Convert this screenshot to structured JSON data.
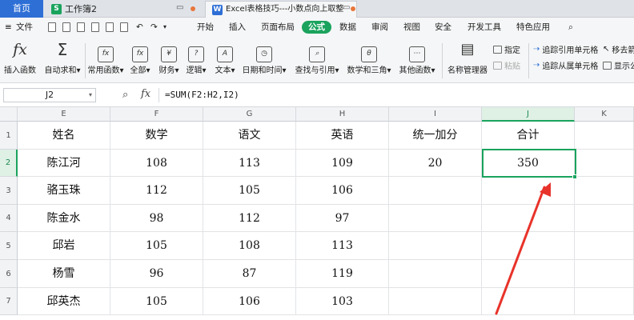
{
  "tabs": {
    "home": "首页",
    "workbook": "工作簿2",
    "doc": "Excel表格技巧---小数点向上取整"
  },
  "menu": {
    "file": "文件",
    "items": [
      "开始",
      "插入",
      "页面布局",
      "公式",
      "数据",
      "审阅",
      "视图",
      "安全",
      "开发工具",
      "特色应用"
    ],
    "active_index": 3,
    "search": "Q"
  },
  "ribbon": {
    "buttons": [
      {
        "label": "插入函数",
        "icon": "fx"
      },
      {
        "label": "自动求和",
        "icon": "Σ"
      },
      {
        "label": "常用函数",
        "icon": "fx"
      },
      {
        "label": "全部",
        "icon": "fx"
      },
      {
        "label": "财务",
        "icon": "¥"
      },
      {
        "label": "逻辑",
        "icon": "?"
      },
      {
        "label": "文本",
        "icon": "A"
      },
      {
        "label": "日期和时间",
        "icon": "⏲"
      },
      {
        "label": "查找与引用",
        "icon": "⌕"
      },
      {
        "label": "数学和三角",
        "icon": "θ"
      },
      {
        "label": "其他函数",
        "icon": "⋯"
      },
      {
        "label": "名称管理器",
        "icon": "≡"
      }
    ],
    "small": {
      "define": "指定",
      "paste": "粘贴",
      "trace_precedents": "追踪引用单元格",
      "trace_dependents": "追踪从属单元格",
      "remove_arrows": "移去箭",
      "show_formulas": "显示公"
    }
  },
  "formula_bar": {
    "name_box": "J2",
    "fx": "fx",
    "formula": "=SUM(F2:H2,I2)"
  },
  "sheet": {
    "columns": [
      "E",
      "F",
      "G",
      "H",
      "I",
      "J",
      "K"
    ],
    "selected_column": "J",
    "rows": [
      {
        "num": "1",
        "cells": [
          "姓名",
          "数学",
          "语文",
          "英语",
          "统一加分",
          "合计"
        ]
      },
      {
        "num": "2",
        "cells": [
          "陈江河",
          "108",
          "113",
          "109",
          "20",
          "350"
        ]
      },
      {
        "num": "3",
        "cells": [
          "骆玉珠",
          "112",
          "105",
          "106",
          "",
          ""
        ]
      },
      {
        "num": "4",
        "cells": [
          "陈金水",
          "98",
          "112",
          "97",
          "",
          ""
        ]
      },
      {
        "num": "5",
        "cells": [
          "邱岩",
          "105",
          "108",
          "113",
          "",
          ""
        ]
      },
      {
        "num": "6",
        "cells": [
          "杨雪",
          "96",
          "87",
          "119",
          "",
          ""
        ]
      },
      {
        "num": "7",
        "cells": [
          "邱英杰",
          "105",
          "106",
          "103",
          "",
          ""
        ]
      }
    ],
    "selected_row": "2",
    "active_cell": "J2"
  },
  "colors": {
    "accent_green": "#1aa35d",
    "home_blue": "#2e6fd6",
    "arrow_red": "#e8332a"
  }
}
